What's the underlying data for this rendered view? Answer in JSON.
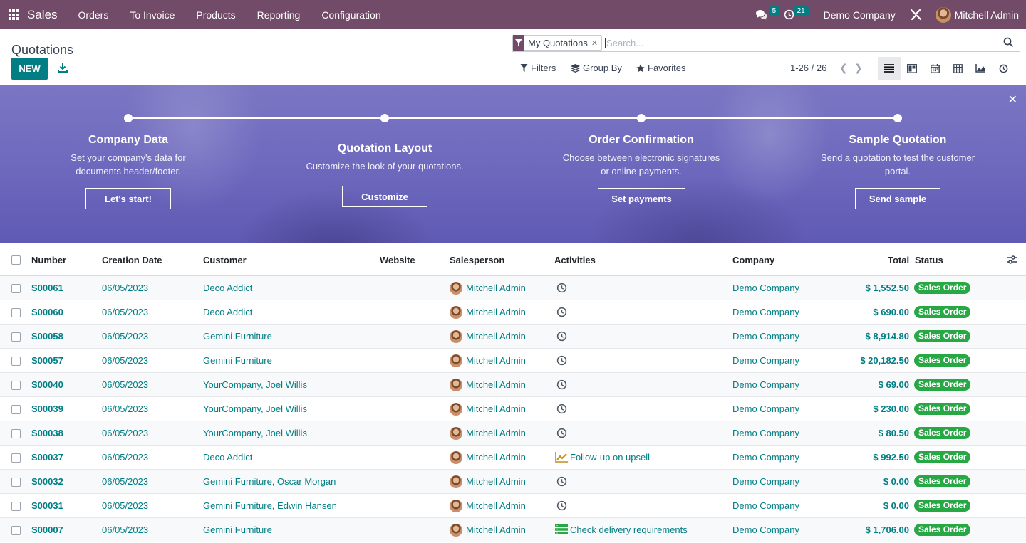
{
  "navbar": {
    "app_name": "Sales",
    "menu": [
      "Orders",
      "To Invoice",
      "Products",
      "Reporting",
      "Configuration"
    ],
    "messages_count": "5",
    "activities_count": "21",
    "company": "Demo Company",
    "user": "Mitchell Admin",
    "bg_color": "#714b67"
  },
  "control": {
    "title": "Quotations",
    "new_label": "NEW",
    "facet_label": "My Quotations",
    "search_placeholder": "Search...",
    "filters_label": "Filters",
    "groupby_label": "Group By",
    "favorites_label": "Favorites",
    "pager": "1-26 / 26",
    "views": [
      "list-view-icon",
      "kanban-view-icon",
      "calendar-view-icon",
      "pivot-view-icon",
      "graph-view-icon",
      "activity-view-icon"
    ],
    "active_view": "list"
  },
  "banner": {
    "steps": [
      {
        "title": "Company Data",
        "desc1": "Set your company's data for",
        "desc2": "documents header/footer.",
        "button": "Let's start!"
      },
      {
        "title": "Quotation Layout",
        "desc1": "Customize the look of your quotations.",
        "desc2": "",
        "button": "Customize"
      },
      {
        "title": "Order Confirmation",
        "desc1": "Choose between electronic signatures",
        "desc2": "or online payments.",
        "button": "Set payments"
      },
      {
        "title": "Sample Quotation",
        "desc1": "Send a quotation to test the customer",
        "desc2": "portal.",
        "button": "Send sample"
      }
    ]
  },
  "table": {
    "headers": {
      "number": "Number",
      "date": "Creation Date",
      "customer": "Customer",
      "website": "Website",
      "salesperson": "Salesperson",
      "activities": "Activities",
      "company": "Company",
      "total": "Total",
      "status": "Status"
    },
    "rows": [
      {
        "number": "S00061",
        "date": "06/05/2023",
        "customer": "Deco Addict",
        "salesperson": "Mitchell Admin",
        "activity": "",
        "company": "Demo Company",
        "total": "$ 1,552.50",
        "status": "Sales Order"
      },
      {
        "number": "S00060",
        "date": "06/05/2023",
        "customer": "Deco Addict",
        "salesperson": "Mitchell Admin",
        "activity": "",
        "company": "Demo Company",
        "total": "$ 690.00",
        "status": "Sales Order"
      },
      {
        "number": "S00058",
        "date": "06/05/2023",
        "customer": "Gemini Furniture",
        "salesperson": "Mitchell Admin",
        "activity": "",
        "company": "Demo Company",
        "total": "$ 8,914.80",
        "status": "Sales Order"
      },
      {
        "number": "S00057",
        "date": "06/05/2023",
        "customer": "Gemini Furniture",
        "salesperson": "Mitchell Admin",
        "activity": "",
        "company": "Demo Company",
        "total": "$ 20,182.50",
        "status": "Sales Order"
      },
      {
        "number": "S00040",
        "date": "06/05/2023",
        "customer": "YourCompany, Joel Willis",
        "salesperson": "Mitchell Admin",
        "activity": "",
        "company": "Demo Company",
        "total": "$ 69.00",
        "status": "Sales Order"
      },
      {
        "number": "S00039",
        "date": "06/05/2023",
        "customer": "YourCompany, Joel Willis",
        "salesperson": "Mitchell Admin",
        "activity": "",
        "company": "Demo Company",
        "total": "$ 230.00",
        "status": "Sales Order"
      },
      {
        "number": "S00038",
        "date": "06/05/2023",
        "customer": "YourCompany, Joel Willis",
        "salesperson": "Mitchell Admin",
        "activity": "",
        "company": "Demo Company",
        "total": "$ 80.50",
        "status": "Sales Order"
      },
      {
        "number": "S00037",
        "date": "06/05/2023",
        "customer": "Deco Addict",
        "salesperson": "Mitchell Admin",
        "activity": "Follow-up on upsell",
        "activity_icon": "upsell-chart-icon",
        "company": "Demo Company",
        "total": "$ 992.50",
        "status": "Sales Order"
      },
      {
        "number": "S00032",
        "date": "06/05/2023",
        "customer": "Gemini Furniture, Oscar Morgan",
        "salesperson": "Mitchell Admin",
        "activity": "",
        "company": "Demo Company",
        "total": "$ 0.00",
        "status": "Sales Order"
      },
      {
        "number": "S00031",
        "date": "06/05/2023",
        "customer": "Gemini Furniture, Edwin Hansen",
        "salesperson": "Mitchell Admin",
        "activity": "",
        "company": "Demo Company",
        "total": "$ 0.00",
        "status": "Sales Order"
      },
      {
        "number": "S00007",
        "date": "06/05/2023",
        "customer": "Gemini Furniture",
        "salesperson": "Mitchell Admin",
        "activity": "Check delivery requirements",
        "activity_icon": "todo-list-icon",
        "company": "Demo Company",
        "total": "$ 1,706.00",
        "status": "Sales Order"
      }
    ]
  }
}
